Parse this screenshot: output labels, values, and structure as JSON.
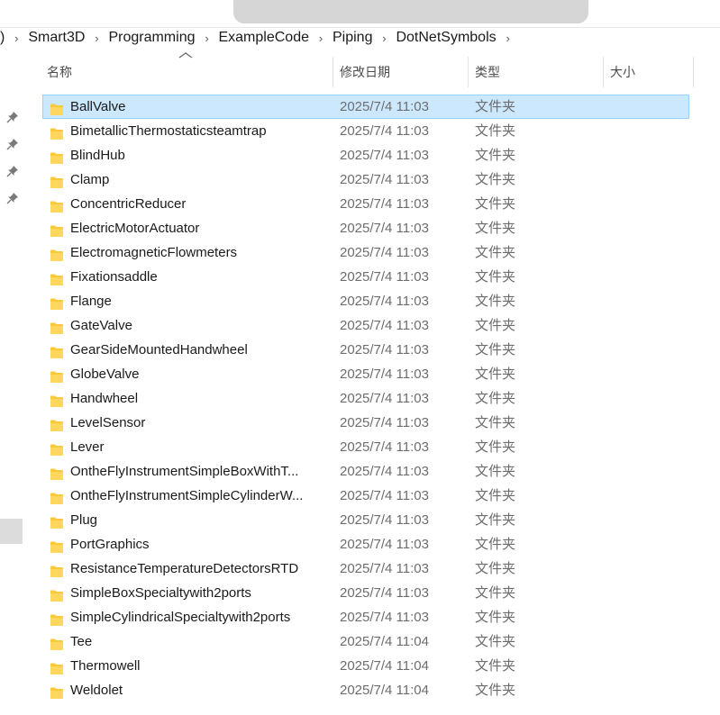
{
  "breadcrumb": {
    "lead": ")",
    "items": [
      "Smart3D",
      "Programming",
      "ExampleCode",
      "Piping",
      "DotNetSymbols"
    ],
    "separator": "›"
  },
  "columns": {
    "name": "名称",
    "date": "修改日期",
    "type": "类型",
    "size": "大小",
    "sort_arrow": "^"
  },
  "colors": {
    "selection_bg": "#cce8ff",
    "selection_border": "#99d1ff",
    "folder_yellow": "#f8c938"
  },
  "rows": [
    {
      "name": "BallValve",
      "date": "2025/7/4 11:03",
      "type": "文件夹",
      "selected": true
    },
    {
      "name": "BimetallicThermostaticsteamtrap",
      "date": "2025/7/4 11:03",
      "type": "文件夹"
    },
    {
      "name": "BlindHub",
      "date": "2025/7/4 11:03",
      "type": "文件夹"
    },
    {
      "name": "Clamp",
      "date": "2025/7/4 11:03",
      "type": "文件夹"
    },
    {
      "name": "ConcentricReducer",
      "date": "2025/7/4 11:03",
      "type": "文件夹"
    },
    {
      "name": "ElectricMotorActuator",
      "date": "2025/7/4 11:03",
      "type": "文件夹"
    },
    {
      "name": "ElectromagneticFlowmeters",
      "date": "2025/7/4 11:03",
      "type": "文件夹"
    },
    {
      "name": "Fixationsaddle",
      "date": "2025/7/4 11:03",
      "type": "文件夹"
    },
    {
      "name": "Flange",
      "date": "2025/7/4 11:03",
      "type": "文件夹"
    },
    {
      "name": "GateValve",
      "date": "2025/7/4 11:03",
      "type": "文件夹"
    },
    {
      "name": "GearSideMountedHandwheel",
      "date": "2025/7/4 11:03",
      "type": "文件夹"
    },
    {
      "name": "GlobeValve",
      "date": "2025/7/4 11:03",
      "type": "文件夹"
    },
    {
      "name": "Handwheel",
      "date": "2025/7/4 11:03",
      "type": "文件夹"
    },
    {
      "name": "LevelSensor",
      "date": "2025/7/4 11:03",
      "type": "文件夹"
    },
    {
      "name": "Lever",
      "date": "2025/7/4 11:03",
      "type": "文件夹"
    },
    {
      "name": "OntheFlyInstrumentSimpleBoxWithT...",
      "date": "2025/7/4 11:03",
      "type": "文件夹"
    },
    {
      "name": "OntheFlyInstrumentSimpleCylinderW...",
      "date": "2025/7/4 11:03",
      "type": "文件夹"
    },
    {
      "name": "Plug",
      "date": "2025/7/4 11:03",
      "type": "文件夹"
    },
    {
      "name": "PortGraphics",
      "date": "2025/7/4 11:03",
      "type": "文件夹"
    },
    {
      "name": "ResistanceTemperatureDetectorsRTD",
      "date": "2025/7/4 11:03",
      "type": "文件夹"
    },
    {
      "name": "SimpleBoxSpecialtywith2ports",
      "date": "2025/7/4 11:03",
      "type": "文件夹"
    },
    {
      "name": "SimpleCylindricalSpecialtywith2ports",
      "date": "2025/7/4 11:03",
      "type": "文件夹"
    },
    {
      "name": "Tee",
      "date": "2025/7/4 11:04",
      "type": "文件夹"
    },
    {
      "name": "Thermowell",
      "date": "2025/7/4 11:04",
      "type": "文件夹"
    },
    {
      "name": "Weldolet",
      "date": "2025/7/4 11:04",
      "type": "文件夹"
    }
  ],
  "icons": {
    "folder": "folder-icon",
    "pin": "pin-icon",
    "chevron": "chevron-right-icon",
    "sort": "sort-ascending-icon"
  }
}
